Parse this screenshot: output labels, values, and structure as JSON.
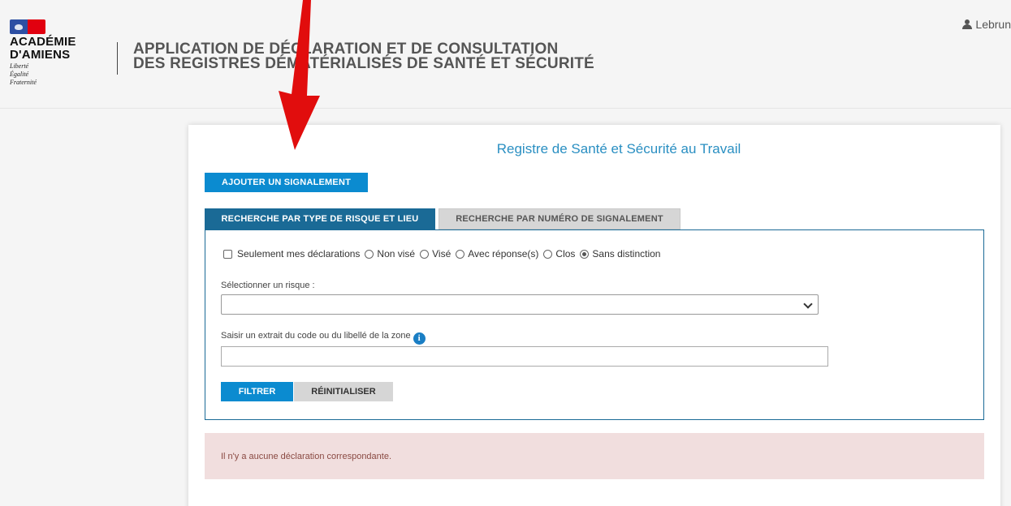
{
  "header": {
    "logo": {
      "name_line1": "ACADÉMIE",
      "name_line2": "D'AMIENS",
      "motto_1": "Liberté",
      "motto_2": "Égalité",
      "motto_3": "Fraternité"
    },
    "title_line1": "APPLICATION DE DÉCLARATION ET DE CONSULTATION",
    "title_line2": "DES REGISTRES DÉMATÉRIALISÉS DE SANTÉ ET SÉCURITÉ",
    "user": {
      "name": "Lebrun",
      "icon": "user-icon"
    }
  },
  "annotation": {
    "arrow_color": "#e10d0d"
  },
  "panel": {
    "title": "Registre de Santé et Sécurité au Travail",
    "add_button": "AJOUTER UN SIGNALEMENT",
    "tabs": [
      {
        "label": "RECHERCHE PAR TYPE DE RISQUE ET LIEU",
        "active": true
      },
      {
        "label": "RECHERCHE PAR NUMÉRO DE SIGNALEMENT",
        "active": false
      }
    ],
    "filters": {
      "only_mine": {
        "label": "Seulement mes déclarations",
        "checked": false
      },
      "status_options": [
        {
          "label": "Non visé",
          "selected": false
        },
        {
          "label": "Visé",
          "selected": false
        },
        {
          "label": "Avec réponse(s)",
          "selected": false
        },
        {
          "label": "Clos",
          "selected": false
        },
        {
          "label": "Sans distinction",
          "selected": true
        }
      ]
    },
    "risk_select": {
      "label": "Sélectionner un risque :",
      "value": ""
    },
    "zone_input": {
      "label": "Saisir un extrait du code ou du libellé de la zone",
      "value": ""
    },
    "filter_button": "FILTRER",
    "reset_button": "RÉINITIALISER",
    "alert_message": "Il n'y a aucune déclaration correspondante."
  },
  "colors": {
    "primary": "#0b8bd0",
    "tab_active": "#1a6a96",
    "title": "#2a8fc2",
    "alert_bg": "#f1dede",
    "alert_text": "#8a4a43"
  }
}
